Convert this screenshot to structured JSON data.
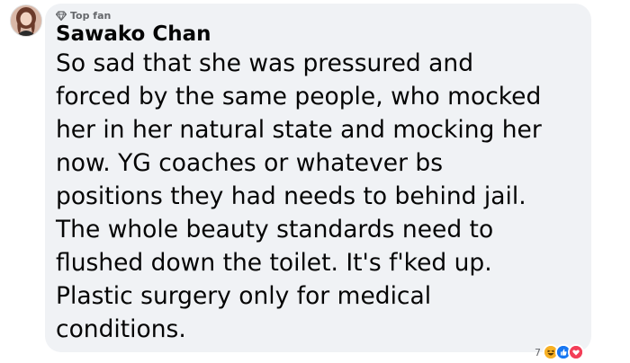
{
  "comment": {
    "author": "Sawako Chan",
    "badge": {
      "label": "Top fan",
      "icon": "diamond-icon"
    },
    "avatar_icon": "profile-photo",
    "text_lines": [
      "So sad that she was pressured and",
      "forced by the same people, who mocked",
      "her in her natural state and mocking her",
      "now. YG coaches or whatever bs",
      "positions they had needs to behind jail.",
      "The whole beauty standards need to",
      "flushed down the toilet. It's f'ked up.",
      "Plastic surgery only for medical",
      "conditions."
    ],
    "reactions": {
      "count": "7",
      "icons": [
        "haha-icon",
        "like-icon",
        "love-icon"
      ],
      "colors": {
        "haha": "#f7b125",
        "like": "#1877f2",
        "love": "#f33e58"
      }
    }
  },
  "colors": {
    "bubble": "#f0f2f5",
    "text": "#050505",
    "secondary": "#65676b"
  }
}
